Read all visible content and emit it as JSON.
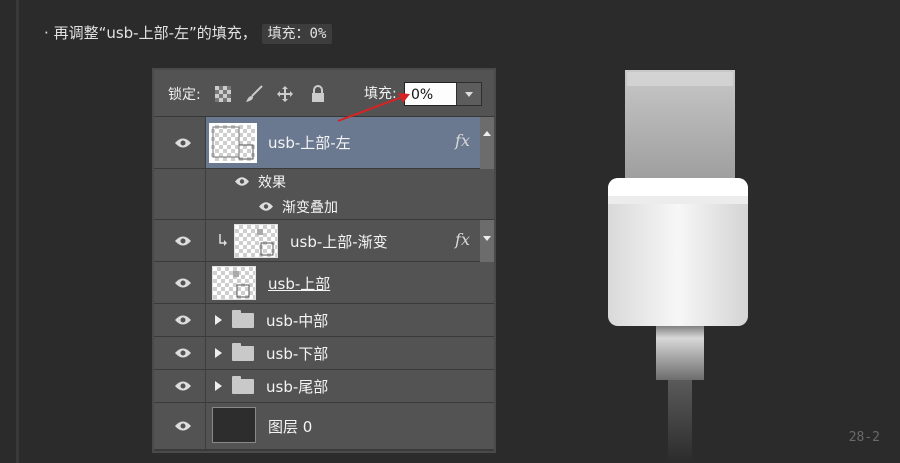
{
  "caption": {
    "bullet": "·",
    "text": "再调整“usb-上部-左”的填充，",
    "code": "填充：0%"
  },
  "page_number": "28-2",
  "panel": {
    "lock_label": "锁定:",
    "lock_icons": [
      "checker-lock-icon",
      "brush-lock-icon",
      "move-lock-icon",
      "padlock-icon"
    ],
    "fill_label": "填充:",
    "fill_value": "0%",
    "layers": [
      {
        "name": "usb-上部-左",
        "selected": true,
        "fx": "fx",
        "effects_label": "效果",
        "effect": "渐变叠加"
      },
      {
        "name": "usb-上部-渐变",
        "clipped": true,
        "fx": "fx"
      },
      {
        "name": "usb-上部",
        "underlined": true
      },
      {
        "name": "usb-中部",
        "group": true
      },
      {
        "name": "usb-下部",
        "group": true
      },
      {
        "name": "usb-尾部",
        "group": true
      },
      {
        "name": "图层 0"
      }
    ]
  },
  "colors": {
    "background": "#2b2b2b",
    "selected_row": "#6a7990",
    "annotation_arrow": "#d62323"
  }
}
